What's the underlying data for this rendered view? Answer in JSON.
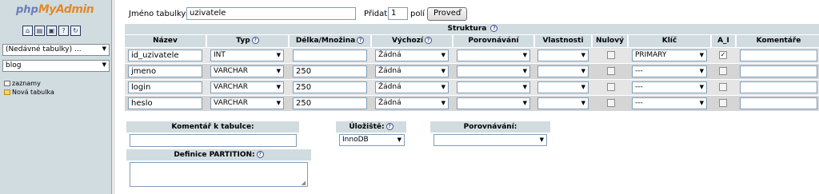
{
  "app": {
    "logo_part1": "php",
    "logo_part2": "MyAdmin"
  },
  "nav": {
    "icons": [
      "home-icon",
      "sql-icon",
      "query-window-icon",
      "docs-icon",
      "reload-icon"
    ],
    "recent_tables_select": "(Nedávné tabulky) ...",
    "database_select": "blog",
    "tables": [
      {
        "label": "zaznamy",
        "icon": "table-icon"
      },
      {
        "label": "Nová tabulka",
        "icon": "new-table-icon"
      }
    ]
  },
  "table_form": {
    "table_name_label": "Jméno tabulky:",
    "table_name_value": "uzivatele",
    "add_label": "Přidat",
    "add_count": "1",
    "add_suffix": "polí",
    "go_button": "Proveď"
  },
  "structure": {
    "title": "Struktura",
    "columns": [
      "Název",
      "Typ",
      "Délka/Množina",
      "Výchozí",
      "Porovnávání",
      "Vlastnosti",
      "Nulový",
      "Klíč",
      "A_I",
      "Komentáře"
    ],
    "help_columns": [
      "Typ",
      "Délka/Množina",
      "Výchozí"
    ],
    "rows": [
      {
        "name": "id_uzivatele",
        "type": "INT",
        "length": "",
        "default": "Žádná",
        "collation": "",
        "attributes": "",
        "null": false,
        "key": "PRIMARY",
        "ai": true,
        "comment": ""
      },
      {
        "name": "jmeno",
        "type": "VARCHAR",
        "length": "250",
        "default": "Žádná",
        "collation": "",
        "attributes": "",
        "null": false,
        "key": "---",
        "ai": false,
        "comment": ""
      },
      {
        "name": "login",
        "type": "VARCHAR",
        "length": "250",
        "default": "Žádná",
        "collation": "",
        "attributes": "",
        "null": false,
        "key": "---",
        "ai": false,
        "comment": ""
      },
      {
        "name": "heslo",
        "type": "VARCHAR",
        "length": "250",
        "default": "Žádná",
        "collation": "",
        "attributes": "",
        "null": false,
        "key": "---",
        "ai": false,
        "comment": ""
      }
    ]
  },
  "table_comment": {
    "label": "Komentář k tabulce:",
    "value": ""
  },
  "storage": {
    "label": "Úložiště:",
    "value": "InnoDB"
  },
  "collation": {
    "label": "Porovnávání:",
    "value": ""
  },
  "partition": {
    "label": "Definice PARTITION:",
    "value": ""
  },
  "colors": {
    "header_bg": "#d0dce0",
    "row_odd": "#e5e5e5",
    "row_even": "#d5d5d5",
    "nav_bg": "#d0dce0"
  }
}
